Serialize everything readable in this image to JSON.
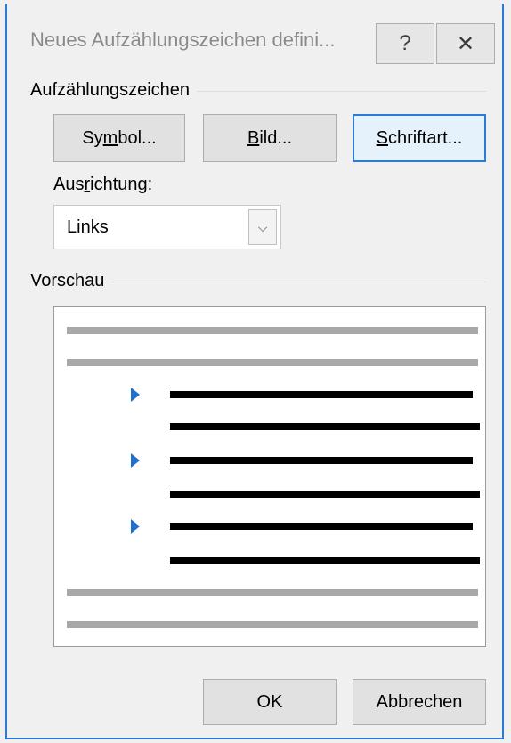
{
  "window": {
    "title": "Neues Aufzählungszeichen defini...",
    "help_icon": "?",
    "close_icon": "✕"
  },
  "bullet_section": {
    "label": "Aufzählungszeichen",
    "buttons": {
      "symbol": {
        "pre": "Sy",
        "accel": "m",
        "post": "bol..."
      },
      "bild": {
        "pre": "",
        "accel": "B",
        "post": "ild..."
      },
      "schriftart": {
        "pre": "",
        "accel": "S",
        "post": "chriftart..."
      }
    }
  },
  "alignment": {
    "label_pre": "Aus",
    "label_accel": "r",
    "label_post": "ichtung:",
    "value": "Links",
    "dropdown_icon": "⌵"
  },
  "preview": {
    "label": "Vorschau",
    "bullet_icon": "triangle-bullet",
    "bullet_color": "#1f6fcf"
  },
  "footer": {
    "ok_label": "OK",
    "cancel_label": "Abbrechen"
  }
}
